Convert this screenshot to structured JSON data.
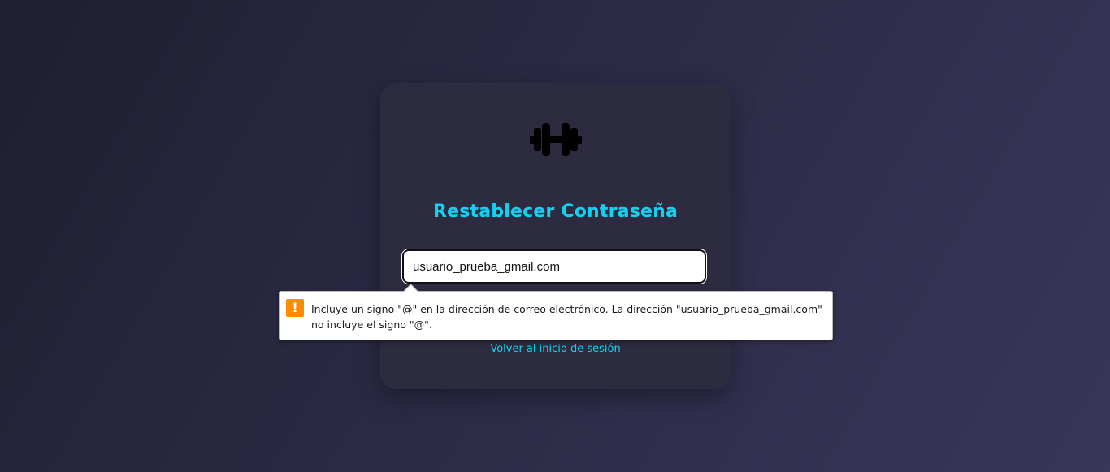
{
  "card": {
    "logo_icon": "dumbbell-icon",
    "title": "Restablecer Contraseña",
    "email": {
      "value": "usuario_prueba_gmail.com"
    },
    "back_link": "Volver al inicio de sesión"
  },
  "validation_tooltip": {
    "icon": "warning-icon",
    "icon_glyph": "!",
    "message": "Incluye un signo \"@\" en la dirección de correo electrónico. La dirección \"usuario_prueba_gmail.com\" no incluye el signo \"@\"."
  },
  "colors": {
    "accent": "#13d2f1",
    "card_bg": "#2c2b3f",
    "warning": "#ff8c00"
  }
}
